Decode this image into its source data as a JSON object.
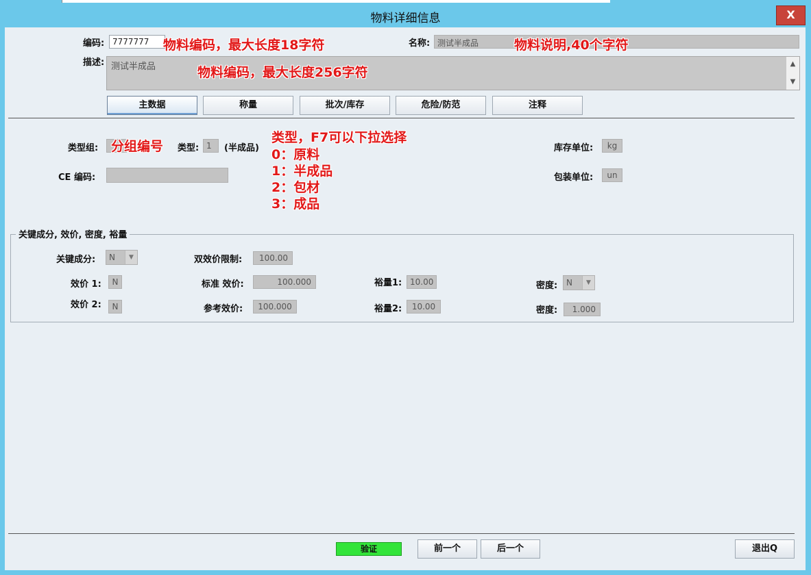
{
  "window": {
    "title": "物料详细信息",
    "close_label": "X"
  },
  "header": {
    "code_label": "编码:",
    "code_value": "7777777",
    "name_label": "名称:",
    "name_value": "测试半成品",
    "desc_label": "描述:",
    "desc_value": "测试半成品"
  },
  "tabs": [
    {
      "label": "主数据",
      "active": true
    },
    {
      "label": "称量"
    },
    {
      "label": "批次/库存"
    },
    {
      "label": "危险/防范"
    },
    {
      "label": "注释"
    }
  ],
  "main": {
    "type_group_label": "类型组:",
    "type_group_value": "",
    "type_label": "类型:",
    "type_value": "1",
    "type_desc": "(半成品)",
    "ce_label": "CE 编码:",
    "ce_value": "",
    "stock_unit_label": "库存单位:",
    "stock_unit_value": "kg",
    "pack_unit_label": "包装单位:",
    "pack_unit_value": "un"
  },
  "group": {
    "title": "关键成分, 效价, 密度, 裕量",
    "key_component_label": "关键成分:",
    "key_component_value": "N",
    "dual_potency_label": "双效价限制:",
    "dual_potency_value": "100.00",
    "potency1_label": "效价 1:",
    "potency1_value": "N",
    "potency2_label": "效价 2:",
    "potency2_value": "N",
    "std_potency_label": "标准 效价:",
    "std_potency_value": "100.000",
    "ref_potency_label": "参考效价:",
    "ref_potency_value": "100.000",
    "margin1_label": "裕量1:",
    "margin1_value": "10.00",
    "margin2_label": "裕量2:",
    "margin2_value": "10.00",
    "density1_label": "密度:",
    "density1_value": "N",
    "density2_label": "密度:",
    "density2_value": "1.000"
  },
  "annotations": {
    "code_note": "物料编码，最大长度18字符",
    "name_note": "物料说明,40个字符",
    "desc_note": "物料编码，最大长度256字符",
    "group_note": "分组编号",
    "type_note_title": "类型，F7可以下拉选择",
    "type_opt_0": "0：原料",
    "type_opt_1": "1：半成品",
    "type_opt_2": "2：包材",
    "type_opt_3": "3：成品"
  },
  "footer": {
    "verify_label": "验证",
    "prev_label": "前一个",
    "next_label": "后一个",
    "exit_label": "退出Q"
  },
  "colors": {
    "titlebar": "#6bc8ea",
    "client_bg": "#e9eff4",
    "close": "#c8443a",
    "annotation": "#e21818",
    "verify": "#33e43a"
  }
}
